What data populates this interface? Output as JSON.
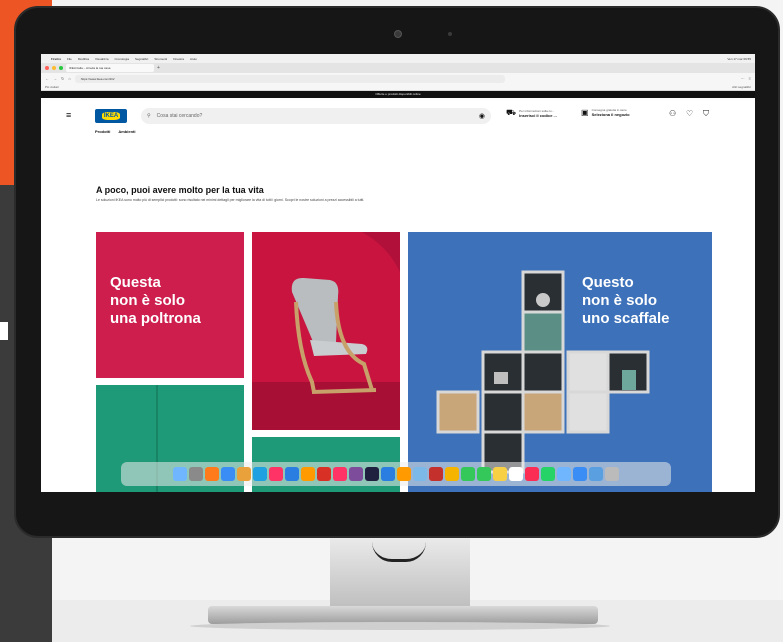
{
  "browser": {
    "menubar": {
      "app": "Firefox",
      "items": [
        "File",
        "Modifica",
        "Visualizza",
        "Cronologia",
        "Segnalibri",
        "Strumenti",
        "Finestra",
        "Aiuto"
      ],
      "clock": "Ven 17 mar 09:55"
    },
    "tab_title": "IKEA Italia – Arreda la tua casa",
    "url": "https://www.ikea.com/it/it/",
    "bookmarks_left": "Più visitati",
    "bookmarks_right": "Altri segnalibri",
    "promo_banner": "Offerte e prodotti disponibili online"
  },
  "ikea": {
    "logo": "IKEA",
    "search_placeholder": "Cosa stai cercando?",
    "delivery": {
      "small": "Per informazioni sulla co...",
      "bold": "Inserisci il codice ..."
    },
    "store": {
      "small": "Consegna gratuita in store",
      "bold": "Seleziona il negozio"
    },
    "subnav": [
      "Prodotti",
      "Ambienti"
    ],
    "headline": "A poco, puoi avere molto per la tua vita",
    "body": "Le soluzioni IKEA sono molto più di semplici prodotti: sono risultato nei minimi dettagli per migliorare la vita di tutti i giorni. Scopri le nostre soluzioni a prezzi accessibili a tutti.",
    "card_left_caption": [
      "Questa",
      "non è solo",
      "una poltrona"
    ],
    "card_right_caption": [
      "Questo",
      "non è solo",
      "uno scaffale"
    ]
  },
  "colors": {
    "ikea_blue": "#0058a3",
    "ikea_yellow": "#ffdb00",
    "card_pink": "#cd1e4e",
    "card_green": "#1f9a79",
    "card_blue": "#3d71b9"
  },
  "dock_icons": [
    "finder-icon",
    "launchpad-icon",
    "firefox-icon",
    "mail-icon",
    "contacts-icon",
    "skype-icon",
    "indesign-icon",
    "photoshop-icon",
    "illustrator-icon",
    "acrobat-icon",
    "indesign-icon",
    "bridge-icon",
    "media-encoder-icon",
    "photoshop-icon",
    "illustrator-icon",
    "preview-icon",
    "filezilla-icon",
    "chrome-icon",
    "facetime-icon",
    "messages-icon",
    "notes-icon",
    "calendar-icon",
    "music-icon",
    "whatsapp-icon",
    "finder-icon",
    "mail-icon",
    "folder-icon",
    "trash-icon"
  ]
}
